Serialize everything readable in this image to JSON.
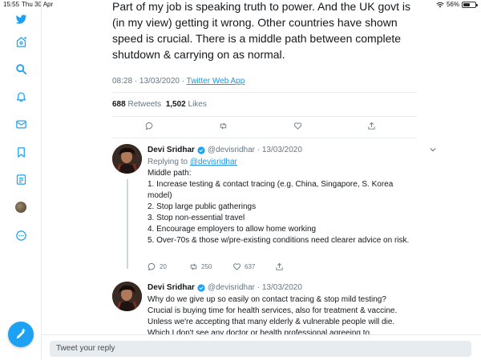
{
  "status_bar": {
    "time": "15:55",
    "date": "Thu 30 Apr",
    "battery": "56%",
    "battery_level": 0.56
  },
  "sidebar": {
    "items": [
      {
        "icon": "twitter-bird-icon"
      },
      {
        "icon": "home-icon"
      },
      {
        "icon": "search-icon"
      },
      {
        "icon": "notifications-icon"
      },
      {
        "icon": "messages-icon"
      },
      {
        "icon": "bookmarks-icon"
      },
      {
        "icon": "lists-icon"
      },
      {
        "icon": "profile-avatar-icon"
      },
      {
        "icon": "more-icon"
      }
    ],
    "compose_icon": "compose-tweet-icon"
  },
  "main_tweet": {
    "text": "Part of my job is speaking truth to power. And the UK govt is (in my view) getting it wrong. Other countries have shown speed is crucial. There is a middle path between complete shutdown & carrying on as normal.",
    "time": "08:28 · 13/03/2020 · ",
    "source": "Twitter Web App",
    "retweets": "688",
    "retweets_label": " Retweets  ",
    "likes": "1,502",
    "likes_label": " Likes"
  },
  "replies": [
    {
      "name": "Devi Sridhar",
      "handle": "@devisridhar · 13/03/2020",
      "replying_prefix": "Replying to ",
      "replying_to": "@devisridhar",
      "lines": [
        "Middle path:",
        "1. Increase testing & contact tracing (e.g. China, Singapore, S. Korea model)",
        "2. Stop large public gatherings",
        "3. Stop non-essential travel",
        "4. Encourage employers to allow home working",
        "5. Over-70s & those w/pre-existing conditions need clearer advice on risk."
      ],
      "replies_count": "20",
      "retweets_count": "250",
      "likes_count": "637"
    },
    {
      "name": "Devi Sridhar",
      "handle": "@devisridhar · 13/03/2020",
      "text": "Why do we give up so easily on contact tracing & stop mild testing? Crucial is buying time for health services, also for treatment & vaccine. Unless we're accepting that many elderly & vulnerable people will die. Which I don't see any doctor or health professional agreeing to."
    }
  ],
  "reply_bar": {
    "placeholder": "Tweet your reply"
  },
  "colors": {
    "accent": "#1da1f2",
    "link": "#1b95e0",
    "muted": "#657786",
    "verified": "#1da1f2"
  }
}
